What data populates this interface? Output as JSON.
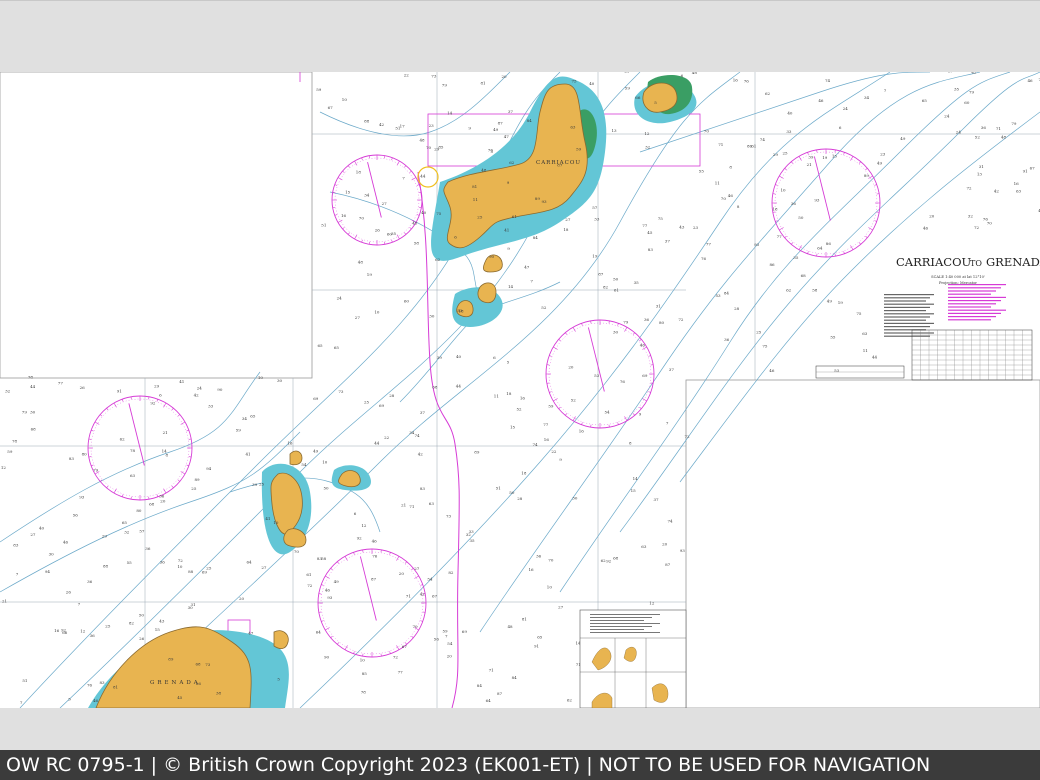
{
  "chart": {
    "title_main": "CARRIACOU",
    "title_to": "TO",
    "title_end": "GRENADA",
    "scale_line": "SCALE 1:40 000 at lat 12°10'",
    "projection_line": "Projection: Mercator",
    "place_carriacou": "CARRIACOU",
    "place_grenada": "GRENADA"
  },
  "footer": {
    "text": "OW RC 0795-1 | © British Crown Copyright 2023 (EK001-ET) | NOT TO BE USED FOR NAVIGATION"
  },
  "colors": {
    "land": "#e8b450",
    "land_edge": "#8a6a30",
    "shallow_water": "#63c6d6",
    "drying": "#3a9e64",
    "magenta": "#d63bd6",
    "contour": "#6ba9c9",
    "frame_gray": "#e0e0e0",
    "footer_bg": "#3b3b3b"
  }
}
